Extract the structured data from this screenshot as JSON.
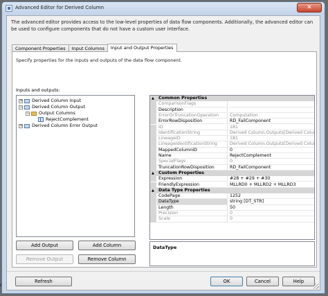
{
  "window": {
    "title": "Advanced Editor for Derived Column",
    "close_glyph": "✕",
    "description": "The advanced editor provides access to the low-level properties of data flow components. Additionally, the advanced editor can be used to configure components that do not have a custom user interface."
  },
  "tabs": [
    {
      "label": "Component Properties"
    },
    {
      "label": "Input Columns"
    },
    {
      "label": "Input and Output Properties"
    }
  ],
  "panel": {
    "description": "Specify properties for the inputs and outputs of the data flow component.",
    "io_label": "Inputs and outputs:"
  },
  "tree": [
    {
      "label": "Derived Column Input",
      "expander": "+"
    },
    {
      "label": "Derived Column Output",
      "expander": "−"
    },
    {
      "label": "Output Columns",
      "expander": "−"
    },
    {
      "label": "RejectComplement"
    },
    {
      "label": "Derived Column Error Output",
      "expander": "+"
    }
  ],
  "buttons": {
    "add_output": "Add Output",
    "add_column": "Add Column",
    "remove_output": "Remove Output",
    "remove_column": "Remove Column",
    "refresh": "Refresh",
    "ok": "OK",
    "cancel": "Cancel",
    "help": "Help"
  },
  "properties": {
    "common": {
      "title": "Common Properties",
      "toggle": "▲",
      "rows": [
        {
          "name": "ComparisonFlags",
          "value": ""
        },
        {
          "name": "Description",
          "value": ""
        },
        {
          "name": "ErrorOrTruncationOperation",
          "value": "Computation"
        },
        {
          "name": "ErrorRowDisposition",
          "value": "RD_FailComponent"
        },
        {
          "name": "ID",
          "value": "181"
        },
        {
          "name": "IdentificationString",
          "value": "Derived Column.Outputs[Derived Column Output]"
        },
        {
          "name": "LineageID",
          "value": "181"
        },
        {
          "name": "LineageIdentificationString",
          "value": "Derived Column.Outputs[Derived Column Output]"
        },
        {
          "name": "MappedColumnID",
          "value": "0"
        },
        {
          "name": "Name",
          "value": "RejectComplement"
        },
        {
          "name": "SpecialFlags",
          "value": "0"
        },
        {
          "name": "TruncationRowDisposition",
          "value": "RD_FailComponent"
        }
      ]
    },
    "custom": {
      "title": "Custom Properties",
      "toggle": "▲",
      "rows": [
        {
          "name": "Expression",
          "value": "#28 + #29 + #30"
        },
        {
          "name": "FriendlyExpression",
          "value": "MLLRD0 + MLLRD2 + MLLRD3"
        }
      ]
    },
    "datatype": {
      "title": "Data Type Properties",
      "toggle": "▲",
      "rows": [
        {
          "name": "CodePage",
          "value": "1252"
        },
        {
          "name": "DataType",
          "value": "string [DT_STR]"
        },
        {
          "name": "Length",
          "value": "50"
        },
        {
          "name": "Precision",
          "value": "0"
        },
        {
          "name": "Scale",
          "value": "0"
        }
      ]
    },
    "selected_description_title": "DataType"
  },
  "background_text": "o"
}
